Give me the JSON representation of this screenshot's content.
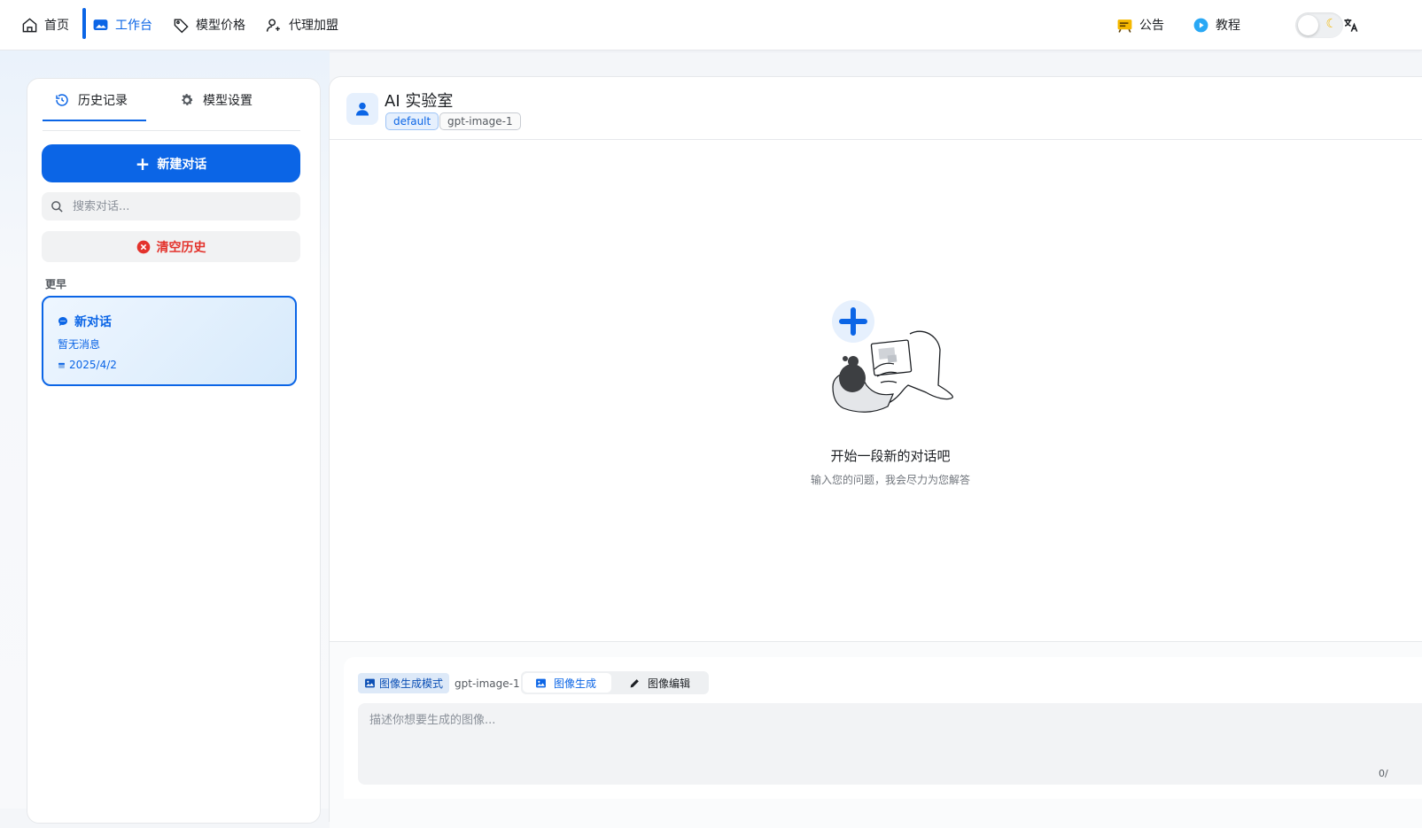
{
  "nav": {
    "items": [
      {
        "label": "首页",
        "icon": "home-icon"
      },
      {
        "label": "工作台",
        "icon": "workspace-icon"
      },
      {
        "label": "模型价格",
        "icon": "price-tag-icon"
      },
      {
        "label": "代理加盟",
        "icon": "user-add-icon"
      }
    ],
    "announcement_label": "公告",
    "tutorial_label": "教程",
    "theme_icon": "moon-icon",
    "language_icon": "translate-icon"
  },
  "sidebar": {
    "tabs": [
      {
        "label": "历史记录",
        "icon": "history-icon"
      },
      {
        "label": "模型设置",
        "icon": "gear-icon"
      }
    ],
    "new_chat_label": "新建对话",
    "search_placeholder": "搜索对话...",
    "clear_label": "清空历史",
    "section_label": "更早",
    "chats": [
      {
        "title": "新对话",
        "preview": "暂无消息",
        "date": "2025/4/2"
      }
    ]
  },
  "main": {
    "title": "AI 实验室",
    "tags": [
      "default",
      "gpt-image-1"
    ],
    "empty_title": "开始一段新的对话吧",
    "empty_subtitle": "输入您的问题，我会尽力为您解答"
  },
  "composer": {
    "mode_label": "图像生成模式",
    "model": "gpt-image-1",
    "generate_label": "图像生成",
    "edit_label": "图像编辑",
    "prompt_placeholder": "描述你想要生成的图像...",
    "counter": "0/"
  },
  "colors": {
    "accent": "#0b65e6",
    "danger": "#e3322b"
  }
}
